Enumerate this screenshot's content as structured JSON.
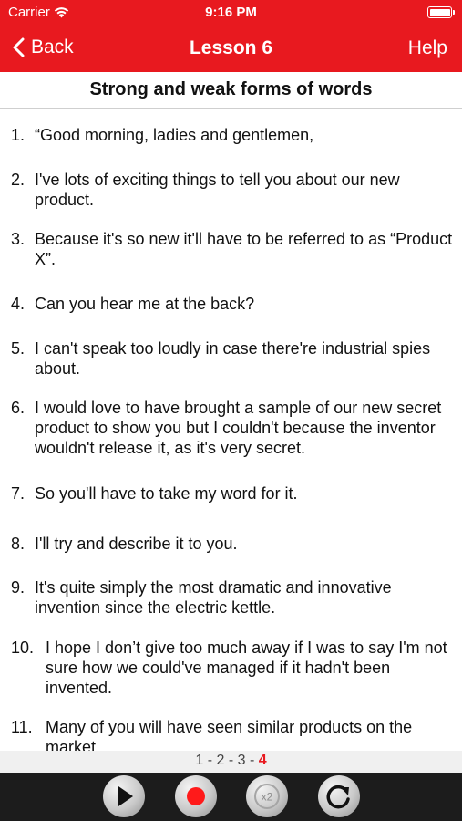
{
  "status_bar": {
    "carrier": "Carrier",
    "time": "9:16 PM"
  },
  "nav": {
    "back_label": "Back",
    "title": "Lesson 6",
    "help_label": "Help"
  },
  "section_title": "Strong and weak forms of words",
  "items": [
    {
      "num": "1.",
      "text": "“Good morning, ladies and gentlemen,"
    },
    {
      "num": "2.",
      "text": "I've lots of exciting things to tell you about our new product."
    },
    {
      "num": "3.",
      "text": "Because it's so new it'll have to be referred to as “Product X”."
    },
    {
      "num": "4.",
      "text": "Can you hear me at the back?"
    },
    {
      "num": "5.",
      "text": "I can't speak too loudly in case there're industrial spies about."
    },
    {
      "num": "6.",
      "text": "I would love to have brought a sample of our new secret product to show you but I couldn't because the inventor wouldn't release it, as it's very secret."
    },
    {
      "num": "7.",
      "text": "So you'll have to take my word for it."
    },
    {
      "num": "8.",
      "text": "I'll try and describe it to you."
    },
    {
      "num": "9.",
      "text": "It's quite simply the most dramatic and innovative invention since the electric kettle."
    },
    {
      "num": "10.",
      "text": "I hope I don’t give too much away if I was to say I'm not sure how we could've managed if it hadn't been invented."
    },
    {
      "num": "11.",
      "text": "Many of you will have seen similar products on the market."
    }
  ],
  "pager": {
    "pages": [
      "1",
      "2",
      "3",
      "4"
    ],
    "current": "4",
    "separator": "-"
  },
  "controls": [
    "play-icon",
    "record-icon",
    "speed-x2-icon",
    "replay-icon"
  ],
  "speed_label": "x2",
  "colors": {
    "accent": "#e8191f",
    "control_bar": "#1c1c1c"
  }
}
